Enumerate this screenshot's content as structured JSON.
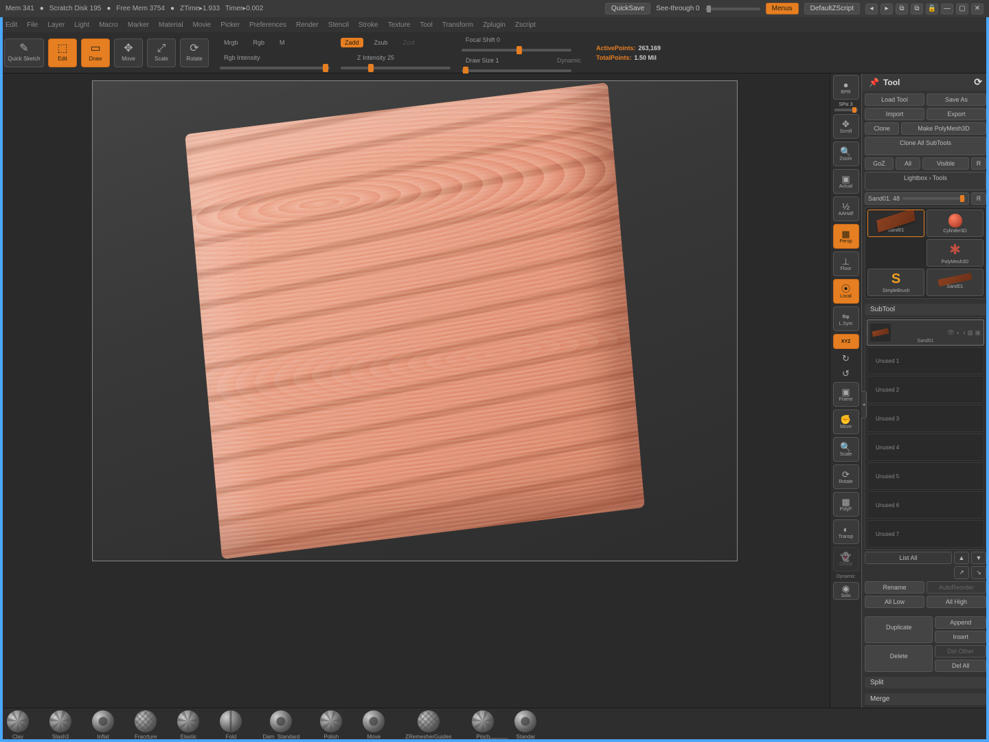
{
  "top": {
    "mem": "Mem 341",
    "scratch": "Scratch Disk 195",
    "free": "Free Mem 3754",
    "ztime": "ZTime▸1.933",
    "timer": "Timer▸0.002",
    "quicksave": "QuickSave",
    "seethrough": "See-through  0",
    "menus": "Menus",
    "defaultzscript": "DefaultZScript"
  },
  "menu": [
    "Edit",
    "File",
    "Layer",
    "Light",
    "Macro",
    "Marker",
    "Material",
    "Movie",
    "Picker",
    "Preferences",
    "Render",
    "Stencil",
    "Stroke",
    "Texture",
    "Tool",
    "Transform",
    "Zplugin",
    "Zscript"
  ],
  "tb": {
    "quicksketch": "Quick Sketch",
    "edit": "Edit",
    "draw": "Draw",
    "move": "Move",
    "scale": "Scale",
    "rotate": "Rotate",
    "mrgb": "Mrgb",
    "rgb": "Rgb",
    "m": "M",
    "rgbint": "Rgb Intensity",
    "zadd": "Zadd",
    "zsub": "Zsub",
    "zcut": "Zcut",
    "zint": "Z Intensity 25",
    "focal": "Focal Shift 0",
    "drawsize": "Draw Size 1",
    "dynamic": "Dynamic",
    "active": "ActivePoints:",
    "activeval": "263,169",
    "total": "TotalPoints:",
    "totalval": "1.50 Mil"
  },
  "side": {
    "bpr": "BPR",
    "spix": "SPix 3",
    "scroll": "Scroll",
    "zoom": "Zoom",
    "actual": "Actual",
    "aahalf": "AAHalf",
    "persp": "Persp",
    "floor": "Floor",
    "local": "Local",
    "lsym": "L.Sym",
    "xyz": "XYZ",
    "frame": "Frame",
    "move": "Move",
    "scale": "Scale",
    "rotate": "Rotate",
    "polyf": "PolyF",
    "transp": "Transp",
    "ghost": "Ghost",
    "dynamic": "Dynamic",
    "solo": "Solo"
  },
  "rp": {
    "title": "Tool",
    "load": "Load Tool",
    "saveas": "Save As",
    "import": "Import",
    "export": "Export",
    "clone": "Clone",
    "polymesh": "Make PolyMesh3D",
    "cloneall": "Clone All SubTools",
    "goz": "GoZ",
    "all": "All",
    "visible": "Visible",
    "r": "R",
    "lightbox": "Lightbox › Tools",
    "toolname": "Sand01. 48",
    "tools": [
      {
        "name": "Sand01",
        "kind": "plank",
        "sel": true
      },
      {
        "name": "Cylinder3D",
        "kind": "cyl"
      },
      {
        "name": "PolyMesh3D",
        "kind": "star"
      },
      {
        "name": "SimpleBrush",
        "kind": "sbrush"
      },
      {
        "name": "Sand01",
        "kind": "sand"
      }
    ],
    "subtool": "SubTool",
    "stname": "Sand01",
    "unused": [
      "Unused 1",
      "Unused 2",
      "Unused 3",
      "Unused 4",
      "Unused 5",
      "Unused 6",
      "Unused 7"
    ],
    "listall": "List All",
    "rename": "Rename",
    "autoreorder": "AutoReorder",
    "alllow": "All Low",
    "allhigh": "All High",
    "duplicate": "Duplicate",
    "append": "Append",
    "insert": "Insert",
    "delete": "Delete",
    "delother": "Del Other",
    "delall": "Del All",
    "split": "Split",
    "merge": "Merge"
  },
  "brushes": [
    {
      "name": "Clay",
      "style": "swirl"
    },
    {
      "name": "Slash3",
      "style": "swirl"
    },
    {
      "name": "Inflat",
      "style": "dot"
    },
    {
      "name": "Fracrture",
      "style": "grid"
    },
    {
      "name": "Elastic",
      "style": "swirl"
    },
    {
      "name": "Fold",
      "style": "line"
    },
    {
      "name": "Dam_Standard",
      "style": "dot"
    },
    {
      "name": "Polish",
      "style": "swirl"
    },
    {
      "name": "Move",
      "style": "dot"
    },
    {
      "name": "ZRemesherGuides",
      "style": "grid"
    },
    {
      "name": "Pinch",
      "style": "swirl"
    },
    {
      "name": "Standar",
      "style": "dot"
    }
  ]
}
